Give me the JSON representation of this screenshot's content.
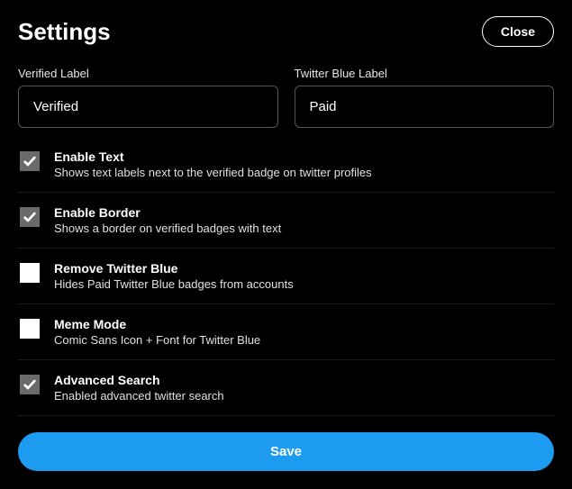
{
  "header": {
    "title": "Settings",
    "close_label": "Close"
  },
  "fields": {
    "verified": {
      "label": "Verified Label",
      "value": "Verified"
    },
    "twitter_blue": {
      "label": "Twitter Blue Label",
      "value": "Paid"
    }
  },
  "options": [
    {
      "title": "Enable Text",
      "desc": "Shows text labels next to the verified badge on twitter profiles",
      "checked": true
    },
    {
      "title": "Enable Border",
      "desc": "Shows a border on verified badges with text",
      "checked": true
    },
    {
      "title": "Remove Twitter Blue",
      "desc": "Hides Paid Twitter Blue badges from accounts",
      "checked": false
    },
    {
      "title": "Meme Mode",
      "desc": "Comic Sans Icon + Font for Twitter Blue",
      "checked": false
    },
    {
      "title": "Advanced Search",
      "desc": "Enabled advanced twitter search",
      "checked": true
    }
  ],
  "actions": {
    "save_label": "Save"
  },
  "colors": {
    "accent": "#1d9bf0",
    "checkbox_checked_bg": "#6a6a6a",
    "checkbox_unchecked_bg": "#ffffff"
  }
}
